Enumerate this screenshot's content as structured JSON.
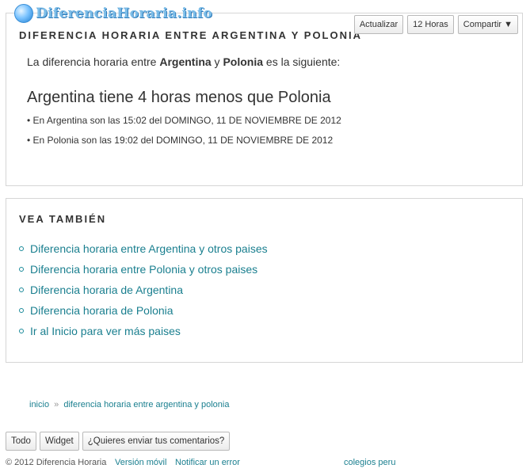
{
  "site": {
    "logo_text": "DiferenciaHoraria.info"
  },
  "toolbar": {
    "refresh_label": "Actualizar",
    "hours_label": "12 Horas",
    "share_label": "Compartir ▼"
  },
  "main": {
    "title": "DIFERENCIA HORARIA ENTRE ARGENTINA Y POLONIA",
    "intro_prefix": "La diferencia horaria entre ",
    "country_a": "Argentina",
    "intro_and": " y ",
    "country_b": "Polonia",
    "intro_suffix": " es la siguiente:",
    "headline": "Argentina tiene 4 horas menos que Polonia",
    "detail_a": "• En Argentina son las 15:02 del DOMINGO, 11 DE NOVIEMBRE DE 2012",
    "detail_b": "• En Polonia son las 19:02 del DOMINGO, 11 DE NOVIEMBRE DE 2012"
  },
  "see_also": {
    "title": "VEA TAMBIÉN",
    "links": [
      "Diferencia horaria entre Argentina y otros paises",
      "Diferencia horaria entre Polonia y otros paises",
      "Diferencia horaria de Argentina",
      "Diferencia horaria de Polonia",
      "Ir al Inicio para ver más paises"
    ]
  },
  "breadcrumb": {
    "home": "inicio",
    "separator": "»",
    "current": "diferencia horaria entre argentina y polonia"
  },
  "footer_buttons": {
    "all": "Todo",
    "widget": "Widget",
    "comments": "¿Quieres enviar tus comentarios?"
  },
  "footer": {
    "copyright": "© 2012 Diferencia Horaria",
    "mobile_version": "Versión móvil",
    "report_error": "Notificar un error",
    "colegios": "colegios peru"
  },
  "colors": {
    "accent_link": "#1a7f8f",
    "border": "#d6d6d6"
  }
}
